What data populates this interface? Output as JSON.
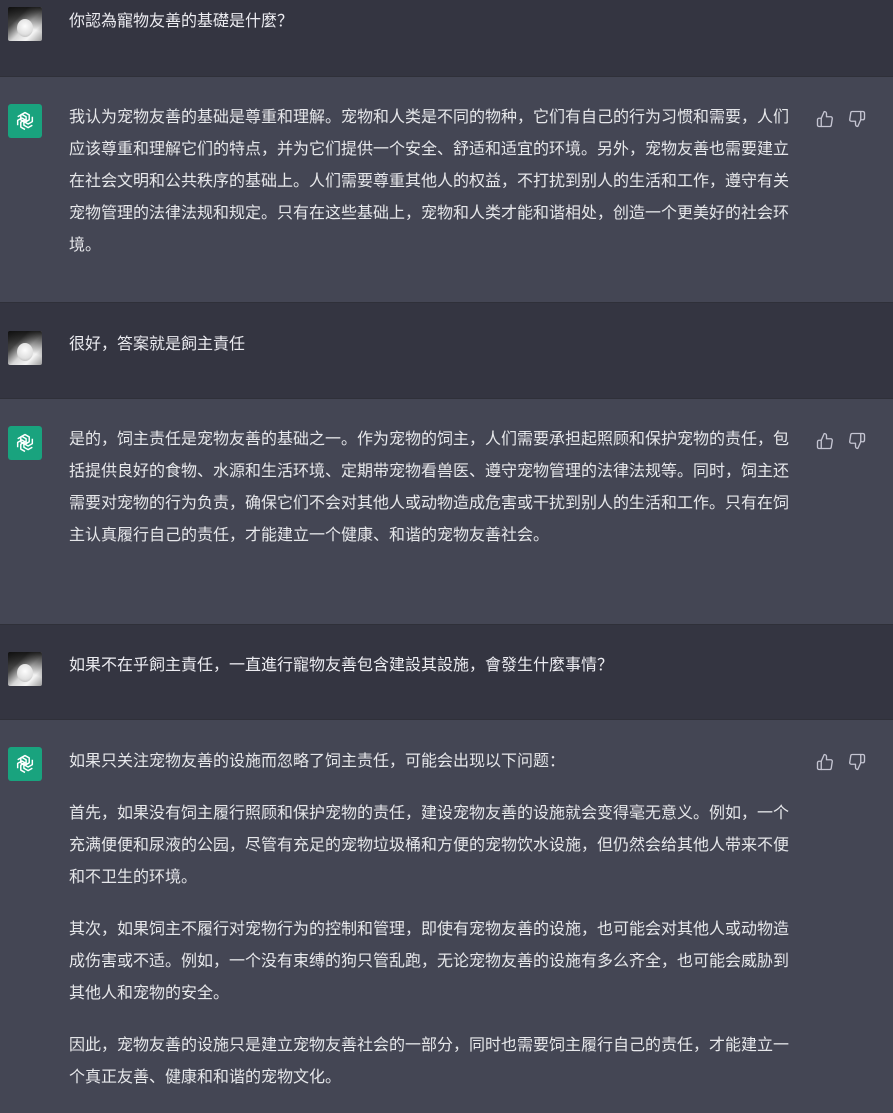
{
  "conversation": [
    {
      "role": "user",
      "avatar": "user-avatar",
      "paragraphs": [
        "你認為寵物友善的基礎是什麼？"
      ]
    },
    {
      "role": "assistant",
      "avatar": "openai-logo-icon",
      "paragraphs": [
        "我认为宠物友善的基础是尊重和理解。宠物和人类是不同的物种，它们有自己的行为习惯和需要，人们应该尊重和理解它们的特点，并为它们提供一个安全、舒适和适宜的环境。另外，宠物友善也需要建立在社会文明和公共秩序的基础上。人们需要尊重其他人的权益，不打扰到别人的生活和工作，遵守有关宠物管理的法律法规和规定。只有在这些基础上，宠物和人类才能和谐相处，创造一个更美好的社会环境。"
      ]
    },
    {
      "role": "user",
      "avatar": "user-avatar",
      "paragraphs": [
        "很好，答案就是飼主責任"
      ]
    },
    {
      "role": "assistant",
      "avatar": "openai-logo-icon",
      "paragraphs": [
        "是的，饲主责任是宠物友善的基础之一。作为宠物的饲主，人们需要承担起照顾和保护宠物的责任，包括提供良好的食物、水源和生活环境、定期带宠物看兽医、遵守宠物管理的法律法规等。同时，饲主还需要对宠物的行为负责，确保它们不会对其他人或动物造成危害或干扰到别人的生活和工作。只有在饲主认真履行自己的责任，才能建立一个健康、和谐的宠物友善社会。"
      ]
    },
    {
      "role": "user",
      "avatar": "user-avatar",
      "paragraphs": [
        "如果不在乎飼主責任，一直進行寵物友善包含建設其設施，會發生什麼事情？"
      ]
    },
    {
      "role": "assistant",
      "avatar": "openai-logo-icon",
      "paragraphs": [
        "如果只关注宠物友善的设施而忽略了饲主责任，可能会出现以下问题：",
        "首先，如果没有饲主履行照顾和保护宠物的责任，建设宠物友善的设施就会变得毫无意义。例如，一个充满便便和尿液的公园，尽管有充足的宠物垃圾桶和方便的宠物饮水设施，但仍然会给其他人带来不便和不卫生的环境。",
        "其次，如果饲主不履行对宠物行为的控制和管理，即使有宠物友善的设施，也可能会对其他人或动物造成伤害或不适。例如，一个没有束缚的狗只管乱跑，无论宠物友善的设施有多么齐全，也可能会威胁到其他人和宠物的安全。",
        "因此，宠物友善的设施只是建立宠物友善社会的一部分，同时也需要饲主履行自己的责任，才能建立一个真正友善、健康和和谐的宠物文化。"
      ]
    }
  ],
  "actions": {
    "thumbs_up": "thumbs-up-icon",
    "thumbs_down": "thumbs-down-icon"
  },
  "colors": {
    "user_bg": "#343541",
    "assistant_bg": "#444654",
    "logo_bg": "#19a37e"
  }
}
